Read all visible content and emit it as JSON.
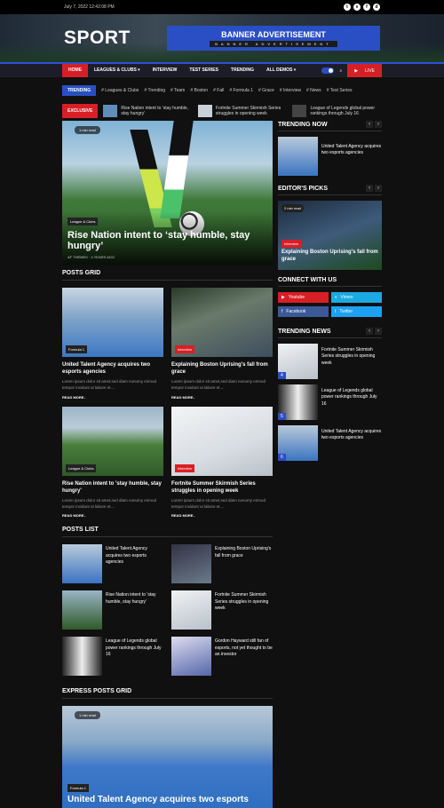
{
  "topbar": {
    "date": "July 7, 2022 12:42:08 PM",
    "social": [
      "t",
      "v",
      "f",
      "d"
    ]
  },
  "header": {
    "logo": "SPORT",
    "banner_title": "BANNER ADVERTISEMENT",
    "banner_sub": "BANNER ADVERTISEMENT"
  },
  "nav": {
    "items": [
      "HOME",
      "LEAGUES & CLUBS",
      "INTERVIEW",
      "TEST SERIES",
      "TRENDING",
      "ALL DEMOS"
    ],
    "live": "LIVE"
  },
  "trending_tags": {
    "label": "TRENDING",
    "tags": [
      "# Leagues & Clubs",
      "# Trending",
      "# Team",
      "# Boston",
      "# Fall",
      "# Formula 1",
      "# Grace",
      "# Interview",
      "# News",
      "# Test Series"
    ]
  },
  "exclusive": {
    "label": "EXCLUSIVE",
    "items": [
      "Rise Nation intent to 'stay humble, stay hungry'",
      "Fortnite Summer Skirmish Series struggles in opening week",
      "League of Legends global power rankings through July 16"
    ]
  },
  "hero": {
    "count": "1 min read",
    "badge": "League & Clubs",
    "title": "Rise Nation intent to ‘stay humble, stay hungry’",
    "meta": "AF THEMES   ·   4 YEARS AGO"
  },
  "posts_grid": {
    "title": "POSTS GRID",
    "cards": [
      {
        "badge": "Formula 1",
        "title": "United Talent Agency acquires two esports agencies",
        "excerpt": "Lorem ipsum dolor sit amet,sed diam nonumy eirmod tempor invidunt ut labore et....",
        "more": "READ MORE.."
      },
      {
        "badge": "Interview",
        "title": "Explaining Boston Uprising's fall from grace",
        "excerpt": "Lorem ipsum dolor sit amet,sed diam nonumy eirmod tempor invidunt ut labore et....",
        "more": "READ MORE.."
      },
      {
        "badge": "League & Clubs",
        "title": "Rise Nation intent to 'stay humble, stay hungry'",
        "excerpt": "Lorem ipsum dolor sit amet,sed diam nonumy eirmod tempor invidunt ut labore et....",
        "more": "READ MORE.."
      },
      {
        "badge": "Interview",
        "title": "Fortnite Summer Skirmish Series struggles in opening week",
        "excerpt": "Lorem ipsum dolor sit amet,sed diam nonumy eirmod tempor invidunt ut labore et....",
        "more": "READ MORE.."
      }
    ]
  },
  "posts_list": {
    "title": "POSTS LIST",
    "items": [
      "United Talent Agency acquires two esports agencies",
      "Explaining Boston Uprising's fall from grace",
      "Rise Nation intent to 'stay humble, stay hungry'",
      "Fortnite Summer Skirmish Series struggles in opening week",
      "League of Legends global power rankings through July 16",
      "Gordon Hayward still fan of esports, not yet thought to be an investor"
    ]
  },
  "express": {
    "title": "EXPRESS POSTS GRID",
    "count": "1 min read",
    "badge": "Formula 1",
    "headline": "United Talent Agency acquires two esports"
  },
  "trending_now": {
    "title": "TRENDING NOW",
    "item": "United Talent Agency acquires two esports agencies"
  },
  "editors_picks": {
    "title": "EDITOR'S PICKS",
    "count": "2 min read",
    "badge": "Interview",
    "item": "Explaining Boston Uprising's fall from grace"
  },
  "connect": {
    "title": "CONNECT WITH US",
    "buttons": [
      "Youtube",
      "Vimeo",
      "Facebook",
      "Twitter"
    ]
  },
  "trending_news": {
    "title": "TRENDING NEWS",
    "items": [
      {
        "n": "4",
        "t": "Fortnite Summer Skirmish Series struggles in opening week"
      },
      {
        "n": "5",
        "t": "League of Legends global power rankings through July 16"
      },
      {
        "n": "6",
        "t": "United Talent Agency acquires two esports agencies"
      }
    ]
  }
}
